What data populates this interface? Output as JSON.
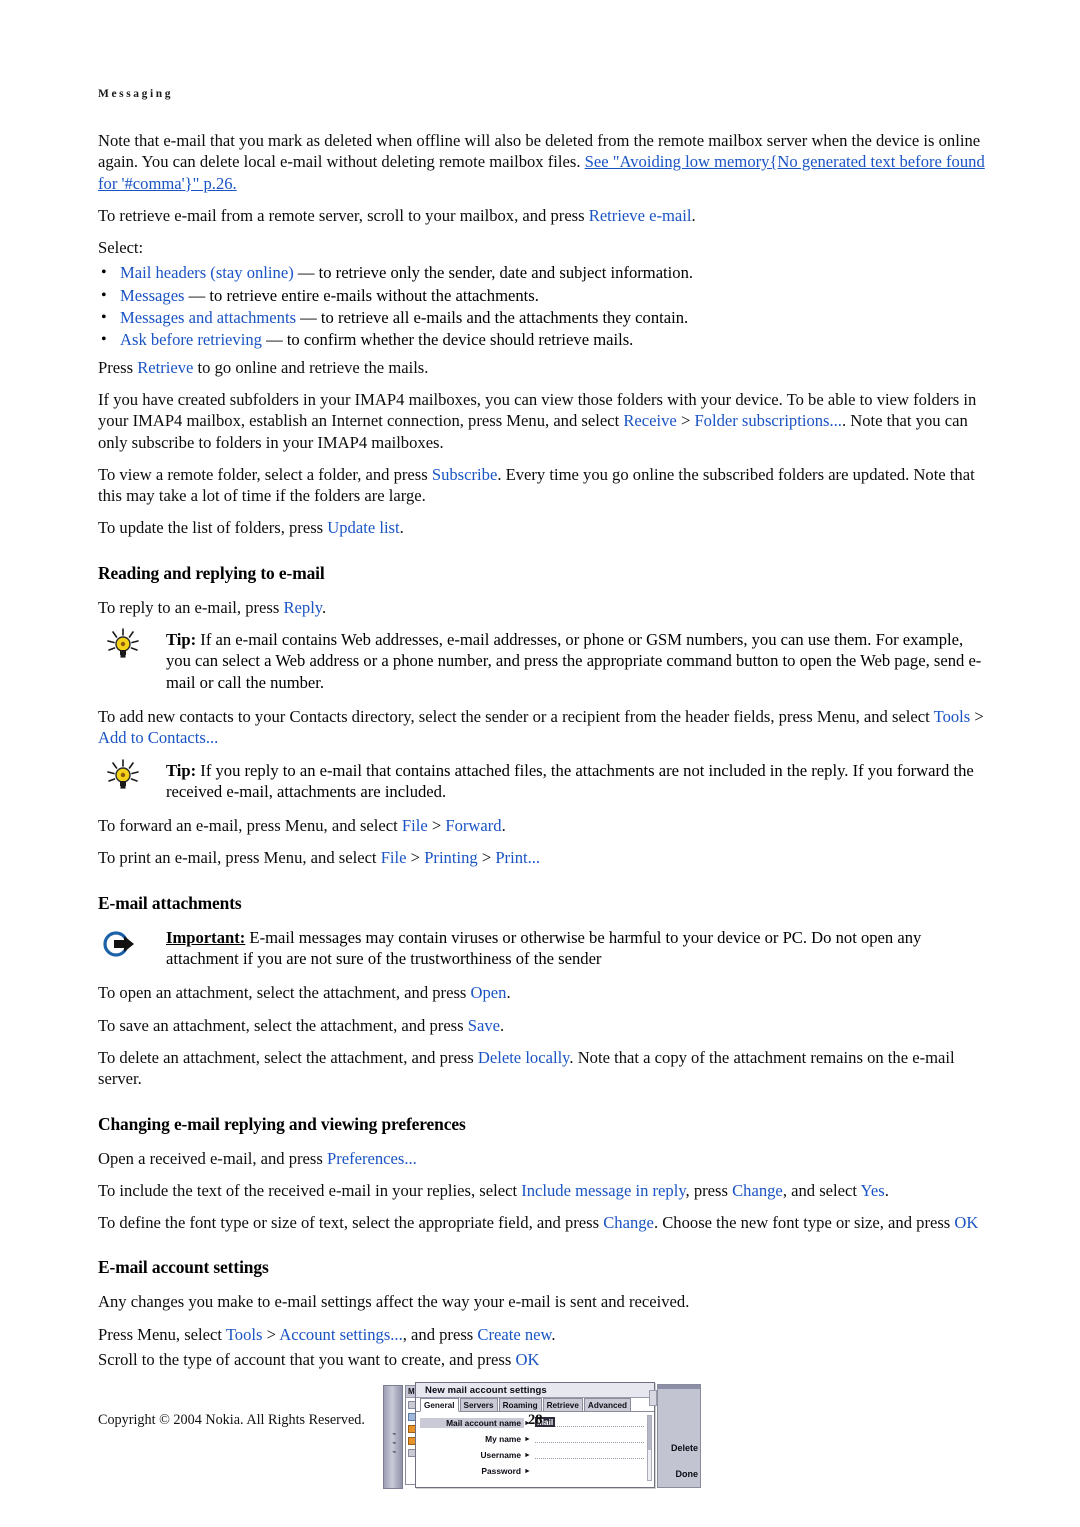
{
  "page": {
    "running_head": "Messaging",
    "page_number": "28",
    "copyright": "Copyright © 2004 Nokia. All Rights Reserved."
  },
  "intro": {
    "para1_part1": "Note that e-mail that you mark as deleted when offline will also be deleted from the remote mailbox server when the device is online again. You can delete local e-mail without deleting remote mailbox files. ",
    "para1_link": "See \"Avoiding low memory{No generated text before found for '#comma'}\" p.26.",
    "para2_part1": "To retrieve e-mail from a remote server, scroll to your mailbox, and press ",
    "para2_link": "Retrieve e-mail",
    "para2_part2": ".",
    "select_label": "Select:"
  },
  "retrieve_options": [
    {
      "term": "Mail headers (stay online)",
      "desc": " — to retrieve only the sender, date and subject information."
    },
    {
      "term": "Messages",
      "desc": " — to retrieve entire e-mails without the attachments."
    },
    {
      "term": "Messages and attachments",
      "desc": " — to retrieve all e-mails and the attachments they contain."
    },
    {
      "term": "Ask before retrieving",
      "desc": " — to confirm whether the device should retrieve mails."
    }
  ],
  "retrieve_press": {
    "part1": "Press ",
    "link": "Retrieve",
    "part2": " to go online and retrieve the mails."
  },
  "imap": {
    "para1_part1": "If you have created subfolders in your IMAP4 mailboxes, you can view those folders with your device. To be able to view folders in your IMAP4 mailbox, establish an Internet connection, press Menu, and select ",
    "para1_link1": "Receive",
    "para1_sep": " > ",
    "para1_link2": "Folder subscriptions...",
    "para1_part2": ". Note that you can only subscribe to folders in your IMAP4 mailboxes.",
    "para2_part1": "To view a remote folder, select a folder, and press ",
    "para2_link": "Subscribe",
    "para2_part2": ". Every time you go online the subscribed folders are updated. Note that this may take a lot of time if the folders are large.",
    "para3_part1": "To update the list of folders, press ",
    "para3_link": "Update list",
    "para3_part2": "."
  },
  "reading": {
    "heading": "Reading and replying to e-mail",
    "reply_part1": "To reply to an e-mail, press ",
    "reply_link": "Reply",
    "reply_part2": ".",
    "tip1_label": "Tip:",
    "tip1_text": " If an e-mail contains Web addresses, e-mail addresses, or phone or GSM numbers, you can use them. For example, you can select a Web address or a phone number, and press the appropriate command button to open the Web page, send e-mail or call the number.",
    "contacts_part1": "To add new contacts to your Contacts directory, select the sender or a recipient from the header fields, press Menu, and select ",
    "contacts_link1": "Tools",
    "contacts_sep": " > ",
    "contacts_link2": "Add to Contacts...",
    "tip2_label": "Tip:",
    "tip2_text": " If you reply to an e-mail that contains attached files, the attachments are not included in the reply. If you forward the received e-mail, attachments are included.",
    "forward_part1": "To forward an e-mail, press Menu, and select ",
    "forward_link1": "File",
    "forward_sep": " > ",
    "forward_link2": "Forward",
    "forward_part2": ".",
    "print_part1": "To print an e-mail, press Menu, and select ",
    "print_link1": "File",
    "print_sep1": " > ",
    "print_link2": "Printing",
    "print_sep2": " > ",
    "print_link3": "Print...",
    "print_part2": ""
  },
  "attachments": {
    "heading": "E-mail attachments",
    "important_label": "Important:",
    "important_text": " E-mail messages may contain viruses or otherwise be harmful to your device or PC. Do not open any attachment if you are not sure of the trustworthiness of the sender",
    "open_part1": "To open an attachment, select the attachment, and press ",
    "open_link": "Open",
    "open_part2": ".",
    "save_part1": "To save an attachment, select the attachment, and press ",
    "save_link": "Save",
    "save_part2": ".",
    "delete_part1": "To delete an attachment, select the attachment, and press ",
    "delete_link": "Delete locally",
    "delete_part2": ". Note that a copy of the attachment remains on the e-mail server."
  },
  "preferences": {
    "heading": "Changing e-mail replying and viewing preferences",
    "open_part1": "Open a received e-mail, and press ",
    "open_link": "Preferences...",
    "open_part2": "",
    "include_part1": "To include the text of the received e-mail in your replies, select ",
    "include_link1": "Include message in reply",
    "include_part2": ", press ",
    "include_link2": "Change",
    "include_part3": ", and select ",
    "include_link3": "Yes",
    "include_part4": ".",
    "font_part1": "To define the font type or size of text, select the appropriate field, and press ",
    "font_link1": "Change",
    "font_part2": ". Choose the new font type or size, and press ",
    "font_link2": "OK",
    "font_part3": ""
  },
  "account_settings": {
    "heading": "E-mail account settings",
    "para1": "Any changes you make to e-mail settings affect the way your e-mail is sent and received.",
    "para2_part1": "Press Menu, select ",
    "para2_link1": "Tools",
    "para2_sep": " > ",
    "para2_link2": "Account settings...",
    "para2_part2": ", and press ",
    "para2_link3": "Create new",
    "para2_part3": ".",
    "para3_part1": "Scroll to the type of account that you want to create, and press ",
    "para3_link": "OK",
    "para3_part2": ""
  },
  "device_screenshot": {
    "background_window_title": "Mailbox",
    "dialog_title": "New mail account settings",
    "tabs": [
      "General",
      "Servers",
      "Roaming",
      "Retrieve",
      "Advanced"
    ],
    "active_tab": "General",
    "fields": [
      {
        "label": "Mail account name",
        "value": "Mail",
        "selected": true
      },
      {
        "label": "My name",
        "value": "",
        "selected": false
      },
      {
        "label": "Username",
        "value": "",
        "selected": false
      },
      {
        "label": "Password",
        "value": "",
        "selected": false
      }
    ],
    "softkeys": [
      "Delete",
      "Done"
    ],
    "signal_strip": "signal-bars"
  },
  "colors": {
    "link_blue": "#1a54c4",
    "tip_icon_yellow": "#f5d218",
    "important_icon_blue": "#1b62a8",
    "text_black": "#0d0d0d"
  },
  "icons": {
    "tip": "lightbulb-icon",
    "important": "arrow-in-circle-icon"
  }
}
